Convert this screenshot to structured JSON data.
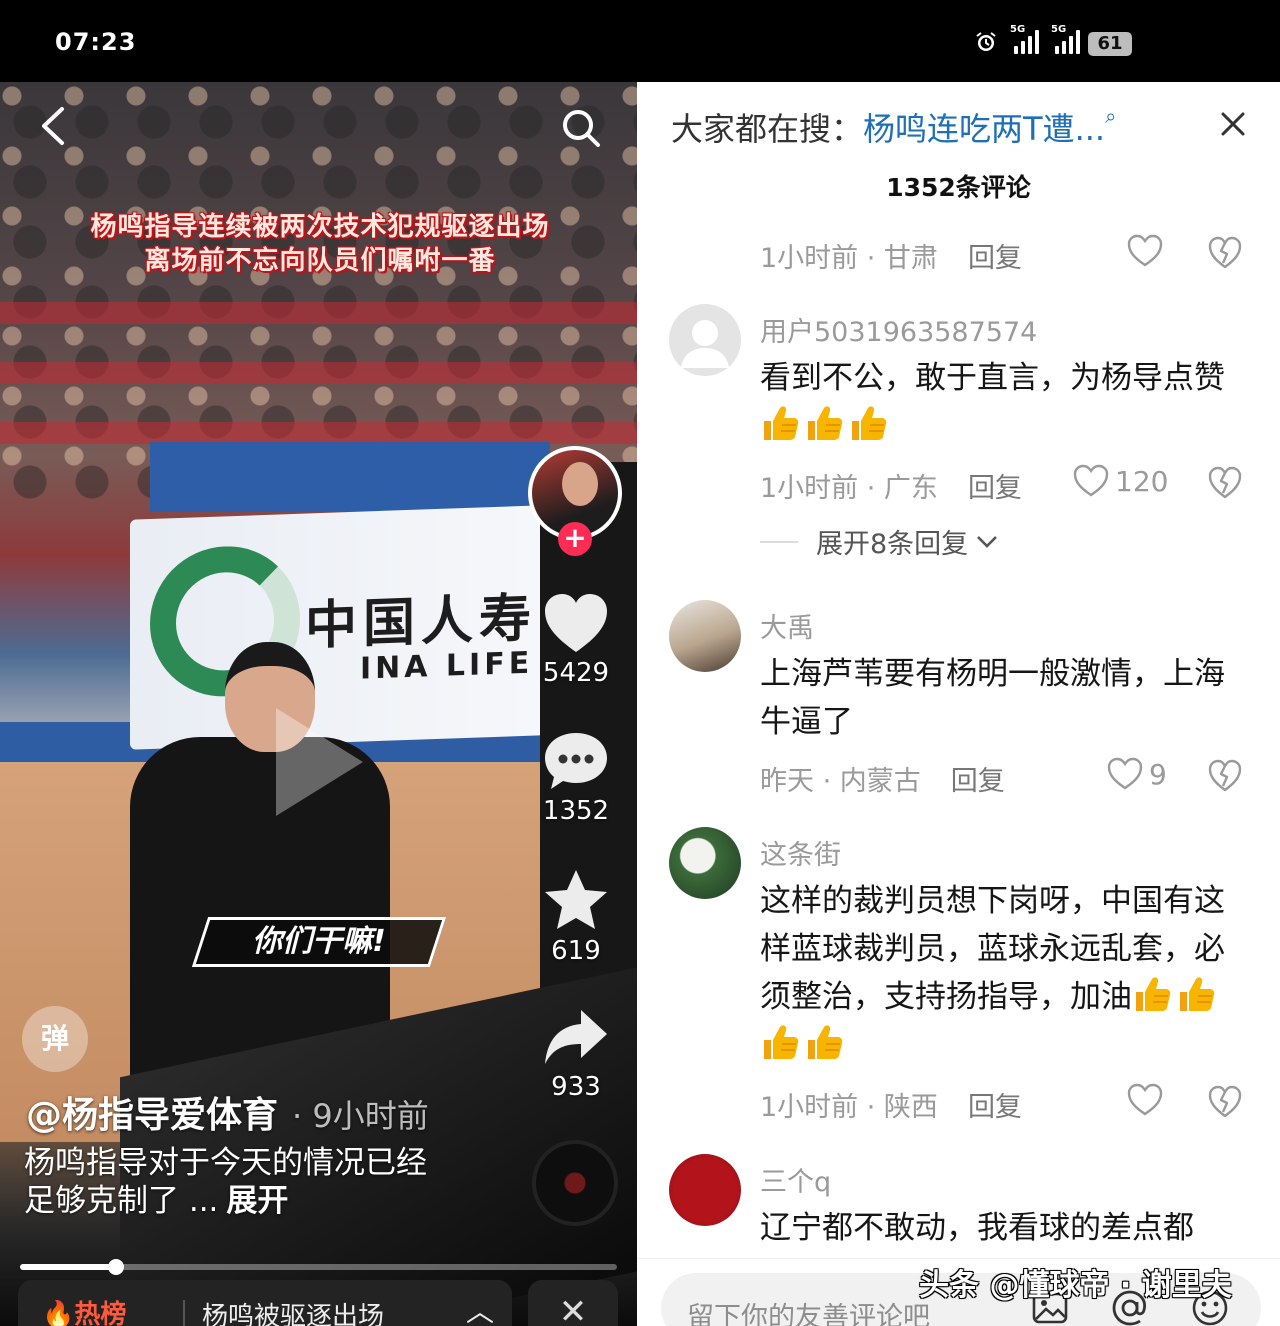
{
  "status_bar": {
    "time": "07:23",
    "network_1": "5G",
    "network_2": "5G",
    "battery": "61"
  },
  "video": {
    "banner_line1": "杨鸣指导连续被两次技术犯规驱逐出场",
    "banner_line2": "离场前不忘向队员们嘱咐一番",
    "caption_bubble": "你们干嘛!",
    "board_cn": "中国人寿",
    "board_en": "INA LIFE",
    "likes": "5429",
    "comments": "1352",
    "favorites": "619",
    "shares": "933",
    "danmu_button": "弹",
    "author": "@杨指导爱体育",
    "post_time": "· 9小时前",
    "description": "杨鸣指导对于今天的情况已经足够克制了 ...",
    "expand_label": "展开",
    "progress": 0.16,
    "hot_label": "热榜",
    "hot_topic": "杨鸣被驱逐出场",
    "hot_arrow": "︿",
    "close_label": "✕"
  },
  "comments_panel": {
    "search_prefix": "大家都在搜：",
    "search_keyword": "杨鸣连吃两T遭...",
    "comment_count": "1352条评论",
    "reply_label": "回复",
    "items": [
      {
        "name": "",
        "text": "",
        "meta": "1小时前 · 甘肃",
        "likes": ""
      },
      {
        "name": "用户5031963587574",
        "text": "看到不公，敢于直言，为杨导点赞",
        "meta": "1小时前 · 广东",
        "likes": "120",
        "expand": "展开8条回复"
      },
      {
        "name": "大禹",
        "text": "上海芦苇要有杨明一般激情，上海牛逼了",
        "meta": "昨天 · 内蒙古",
        "likes": "9"
      },
      {
        "name": "这条街",
        "text": "这样的裁判员想下岗呀，中国有这样蓝球裁判员，蓝球永远乱套，必须整治，支持扬指导，加油",
        "meta": "1小时前 · 陕西",
        "likes": ""
      },
      {
        "name": "三个q",
        "text": "辽宁都不敢动，我看球的差点都",
        "meta": "",
        "likes": ""
      }
    ],
    "input_placeholder": "留下你的友善评论吧",
    "watermark": "头条 @懂球帝 · 谢里夫"
  },
  "colors": {
    "accent_red": "#fe2c55",
    "keyword_blue": "#1f6fb8",
    "hot_orange": "#ff5a3c",
    "thumb_yellow": "#f7b500"
  },
  "icons": [
    "back-arrow-icon",
    "search-icon",
    "play-icon",
    "heart-icon",
    "comment-icon",
    "star-icon",
    "share-icon",
    "close-icon",
    "dislike-heart-icon",
    "image-icon",
    "at-icon",
    "emoji-icon",
    "alarm-icon",
    "signal-icon"
  ]
}
